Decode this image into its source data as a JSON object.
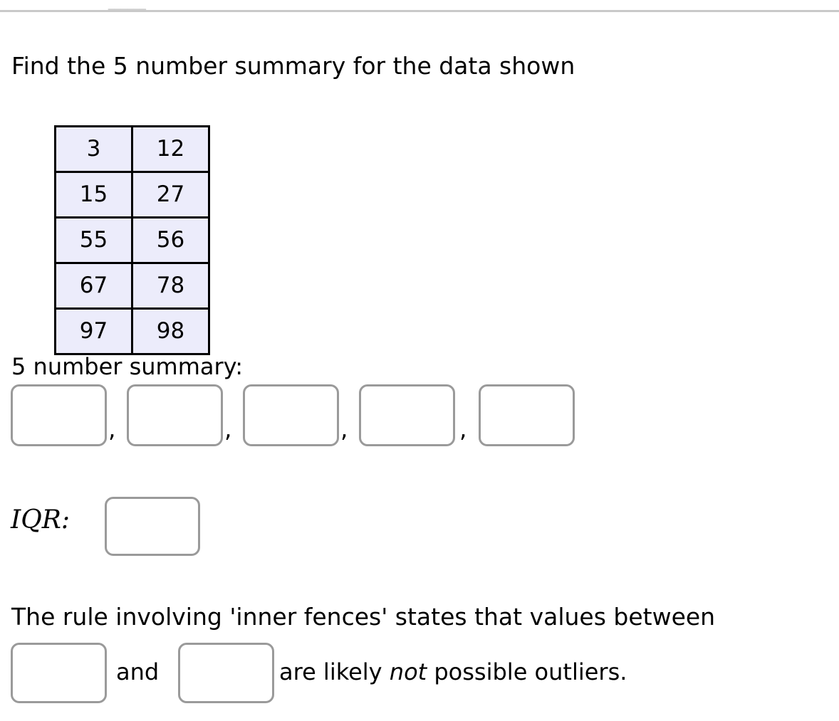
{
  "page": {
    "top_remnant_text": "ــــــ",
    "prompt": "Find the 5 number summary for the data shown"
  },
  "data_table": {
    "rows": [
      [
        "3",
        "12"
      ],
      [
        "15",
        "27"
      ],
      [
        "55",
        "56"
      ],
      [
        "67",
        "78"
      ],
      [
        "97",
        "98"
      ]
    ]
  },
  "summary_section": {
    "label": "5 number summary:",
    "separators": [
      ",",
      ",",
      ",",
      ","
    ],
    "inputs": [
      {
        "name": "minimum",
        "value": "",
        "placeholder": ""
      },
      {
        "name": "q1",
        "value": "",
        "placeholder": ""
      },
      {
        "name": "median",
        "value": "",
        "placeholder": ""
      },
      {
        "name": "q3",
        "value": "",
        "placeholder": ""
      },
      {
        "name": "maximum",
        "value": "",
        "placeholder": ""
      }
    ]
  },
  "iqr_section": {
    "label": "IQR:",
    "input": {
      "value": "",
      "placeholder": ""
    }
  },
  "fences_section": {
    "sentence": "The rule involving 'inner fences' states that values between",
    "conjunction": "and",
    "tail_before_italic": "are likely ",
    "tail_italic": "not",
    "tail_after_italic": " possible outliers.",
    "inputs": [
      {
        "name": "lower-fence",
        "value": "",
        "placeholder": ""
      },
      {
        "name": "upper-fence",
        "value": "",
        "placeholder": ""
      }
    ]
  },
  "colors": {
    "table_cell_background": "#ececfb",
    "table_border": "#000000",
    "input_border": "#9a9a9a",
    "divider": "#c9c9c9",
    "page_background": "#ffffff",
    "text": "#000000"
  }
}
